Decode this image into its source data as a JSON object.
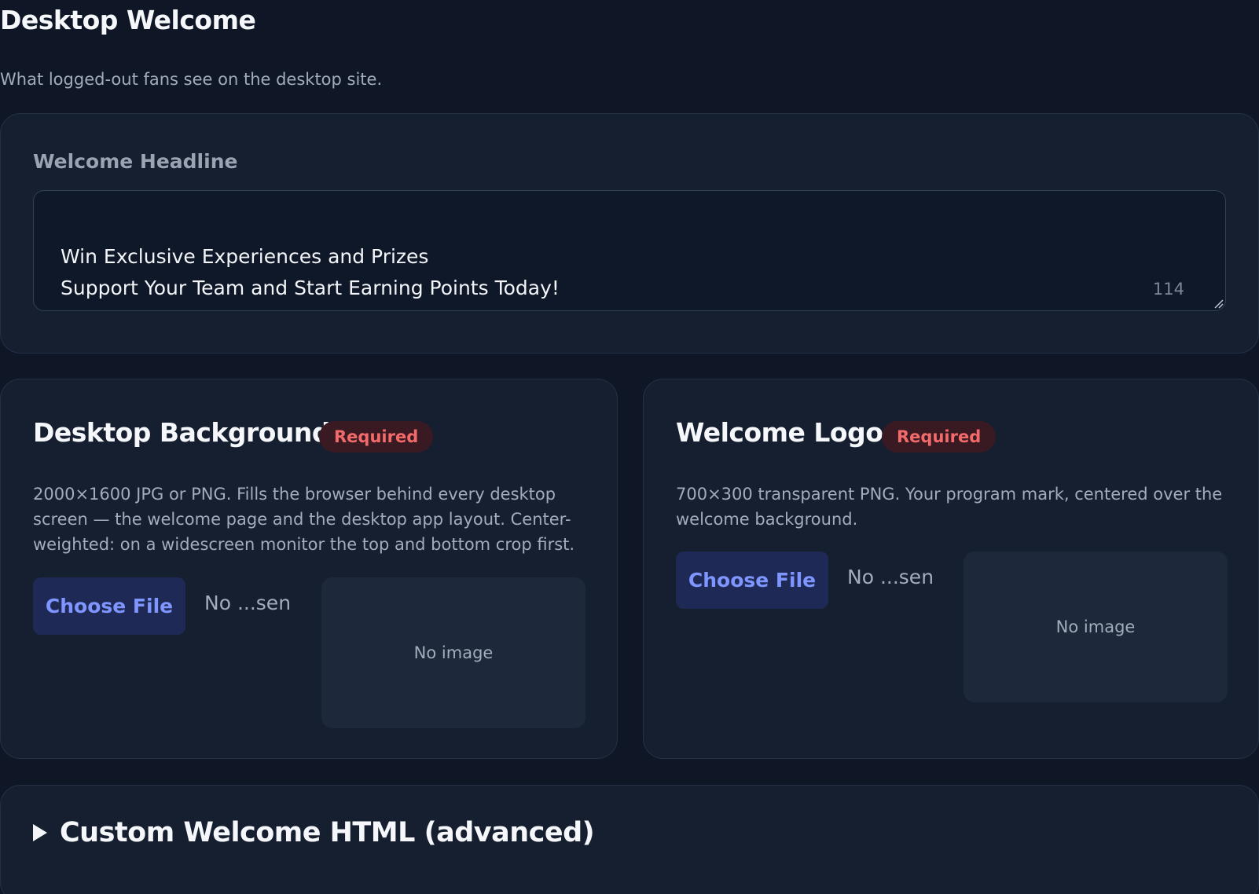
{
  "page": {
    "title": "Desktop Welcome",
    "subtitle": "What logged-out fans see on the desktop site."
  },
  "headline": {
    "label": "Welcome Headline",
    "value": "Win Exclusive Experiences and Prizes\nSupport Your Team and Start Earning Points Today!",
    "char_count": "114"
  },
  "background": {
    "title": "Desktop Background",
    "badge": "Required",
    "description": "2000×1600 JPG or PNG. Fills the browser behind every desktop screen — the welcome page and the desktop app layout. Center-weighted: on a widescreen monitor the top and bottom crop first.",
    "button_label": "Choose File",
    "file_status": "No ...sen",
    "preview_text": "No image"
  },
  "logo": {
    "title": "Welcome Logo",
    "badge": "Required",
    "description": "700×300 transparent PNG. Your program mark, centered over the welcome background.",
    "button_label": "Choose File",
    "file_status": "No ...sen",
    "preview_text": "No image"
  },
  "advanced": {
    "label": "Custom Welcome HTML (advanced)"
  },
  "colors": {
    "page_bg": "#0f1726",
    "card_bg": "#161f30",
    "accent": "#7f95ff",
    "required": "#f26a6a"
  }
}
